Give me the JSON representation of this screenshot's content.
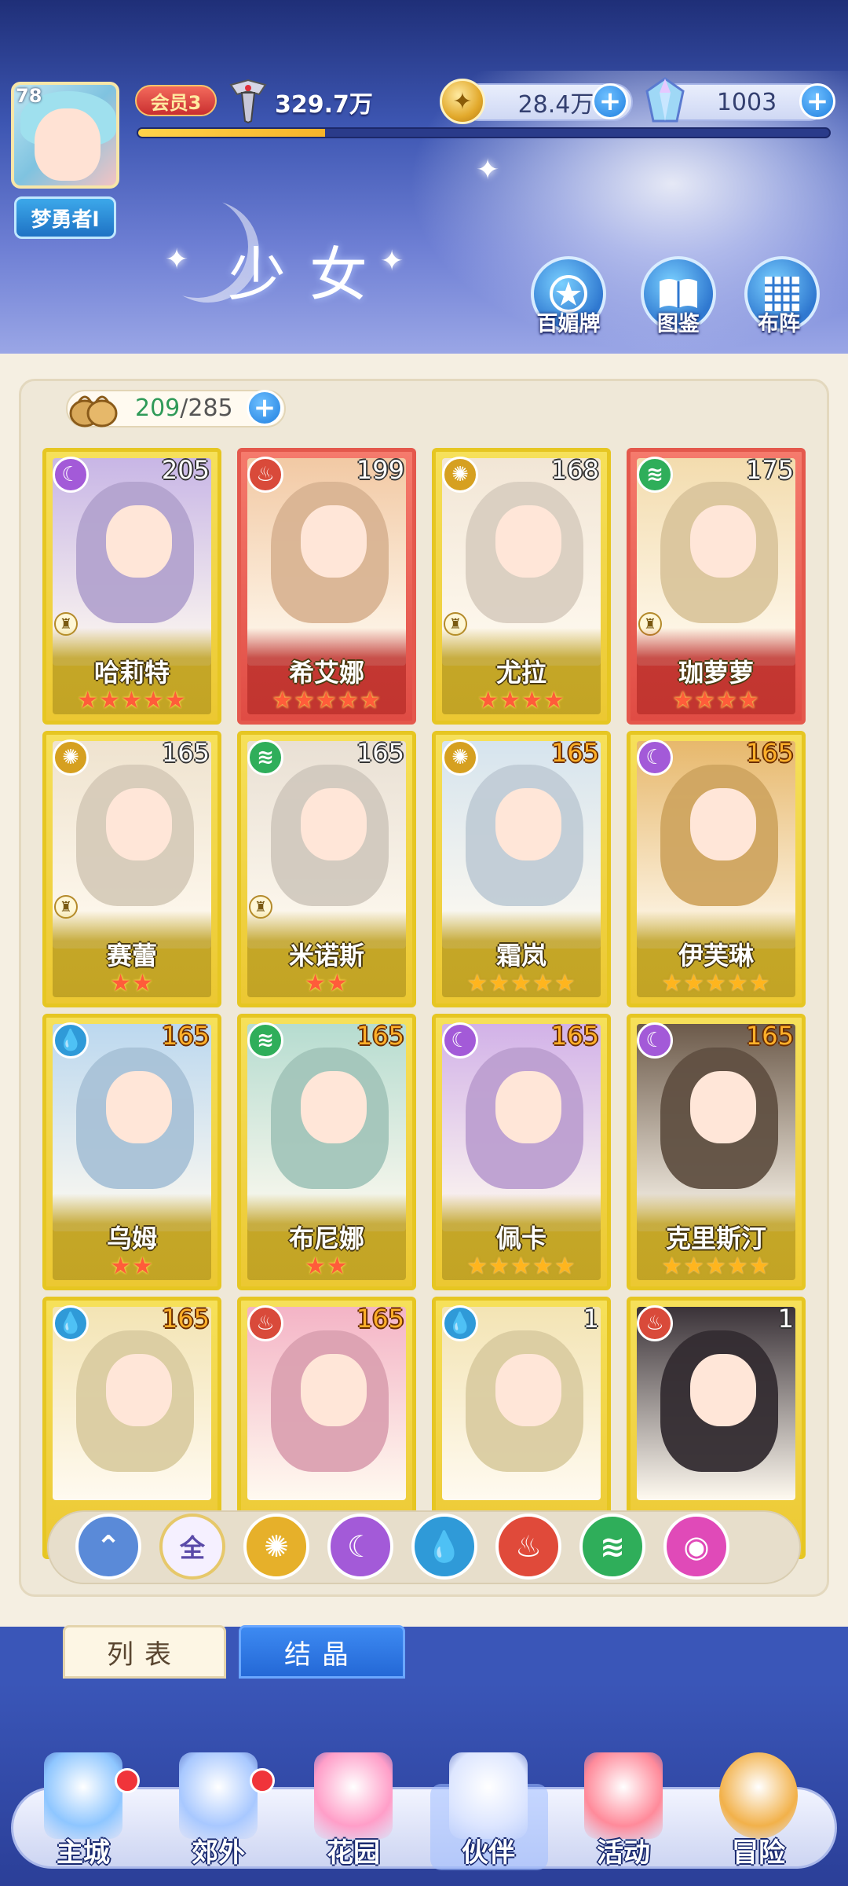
{
  "player": {
    "level": "78",
    "name": "梦勇者l",
    "vip": "会员3",
    "power": "329.7万",
    "exp_progress": 0.27
  },
  "resources": {
    "gold": "28.4万",
    "gems": "1003"
  },
  "page_title": "少女",
  "header_buttons": [
    "百媚牌",
    "图鉴",
    "布阵"
  ],
  "roster": {
    "current": "209",
    "separator": "/",
    "max": "285"
  },
  "cards": [
    {
      "name": "哈莉特",
      "level": "205",
      "element": "moon",
      "stars": "★★★★★",
      "frame": "gold",
      "art": "#c8b6e6"
    },
    {
      "name": "希艾娜",
      "level": "199",
      "element": "fire",
      "stars": "★★★★★",
      "frame": "red",
      "art": "#f2c9a4"
    },
    {
      "name": "尤拉",
      "level": "168",
      "element": "sun",
      "stars": "★★★★",
      "frame": "gold",
      "art": "#f2e6d6"
    },
    {
      "name": "珈萝萝",
      "level": "175",
      "element": "wind",
      "stars": "★★★★",
      "frame": "red",
      "art": "#f3dcae"
    },
    {
      "name": "赛蕾",
      "level": "165",
      "element": "sun",
      "stars": "★★",
      "frame": "gold",
      "art": "#efe3cf"
    },
    {
      "name": "米诺斯",
      "level": "165",
      "element": "wind",
      "stars": "★★",
      "frame": "gold",
      "art": "#e9e0d4"
    },
    {
      "name": "霜岚",
      "level": "165",
      "element": "sun",
      "stars": "★★★★★",
      "frame": "gold",
      "art": "#d6e4ee"
    },
    {
      "name": "伊芙琳",
      "level": "165",
      "element": "moon",
      "stars": "★★★★★",
      "frame": "gold",
      "art": "#e7b86c"
    },
    {
      "name": "乌姆",
      "level": "165",
      "element": "water",
      "stars": "★★",
      "frame": "gold",
      "art": "#bcd8ef"
    },
    {
      "name": "布尼娜",
      "level": "165",
      "element": "wind",
      "stars": "★★",
      "frame": "gold",
      "art": "#b6dcd0"
    },
    {
      "name": "佩卡",
      "level": "165",
      "element": "moon",
      "stars": "★★★★★",
      "frame": "gold",
      "art": "#d2b2e8"
    },
    {
      "name": "克里斯汀",
      "level": "165",
      "element": "moon",
      "stars": "★★★★★",
      "frame": "gold",
      "art": "#6c5a4a"
    },
    {
      "name": "",
      "level": "165",
      "element": "water",
      "stars": "",
      "frame": "gold",
      "art": "#f3e4b4"
    },
    {
      "name": "",
      "level": "165",
      "element": "fire",
      "stars": "",
      "frame": "gold",
      "art": "#f4b4c6"
    },
    {
      "name": "",
      "level": "1",
      "element": "water",
      "stars": "",
      "frame": "gold",
      "art": "#f3e4b4"
    },
    {
      "name": "",
      "level": "1",
      "element": "fire",
      "stars": "",
      "frame": "gold",
      "art": "#3a3238"
    }
  ],
  "filters": [
    {
      "id": "sort",
      "label": "",
      "color": "#5a8ad8"
    },
    {
      "id": "all",
      "label": "全",
      "color": "#f5f0ff"
    },
    {
      "id": "sun",
      "label": "",
      "color": "#e6b02a"
    },
    {
      "id": "moon",
      "label": "",
      "color": "#a35ad8"
    },
    {
      "id": "water",
      "label": "",
      "color": "#2f9ad8"
    },
    {
      "id": "fire",
      "label": "",
      "color": "#e04a3a"
    },
    {
      "id": "wind",
      "label": "",
      "color": "#2fae5a"
    },
    {
      "id": "special",
      "label": "",
      "color": "#e04ab8"
    }
  ],
  "tabs": {
    "list": "列表",
    "crystal": "结晶"
  },
  "nav": [
    "主城",
    "郊外",
    "花园",
    "伙伴",
    "活动",
    "冒险"
  ],
  "element_colors": {
    "moon": "#a35ad8",
    "fire": "#d94a3a",
    "sun": "#d6a020",
    "wind": "#2fae5a",
    "water": "#2f9ad8"
  }
}
